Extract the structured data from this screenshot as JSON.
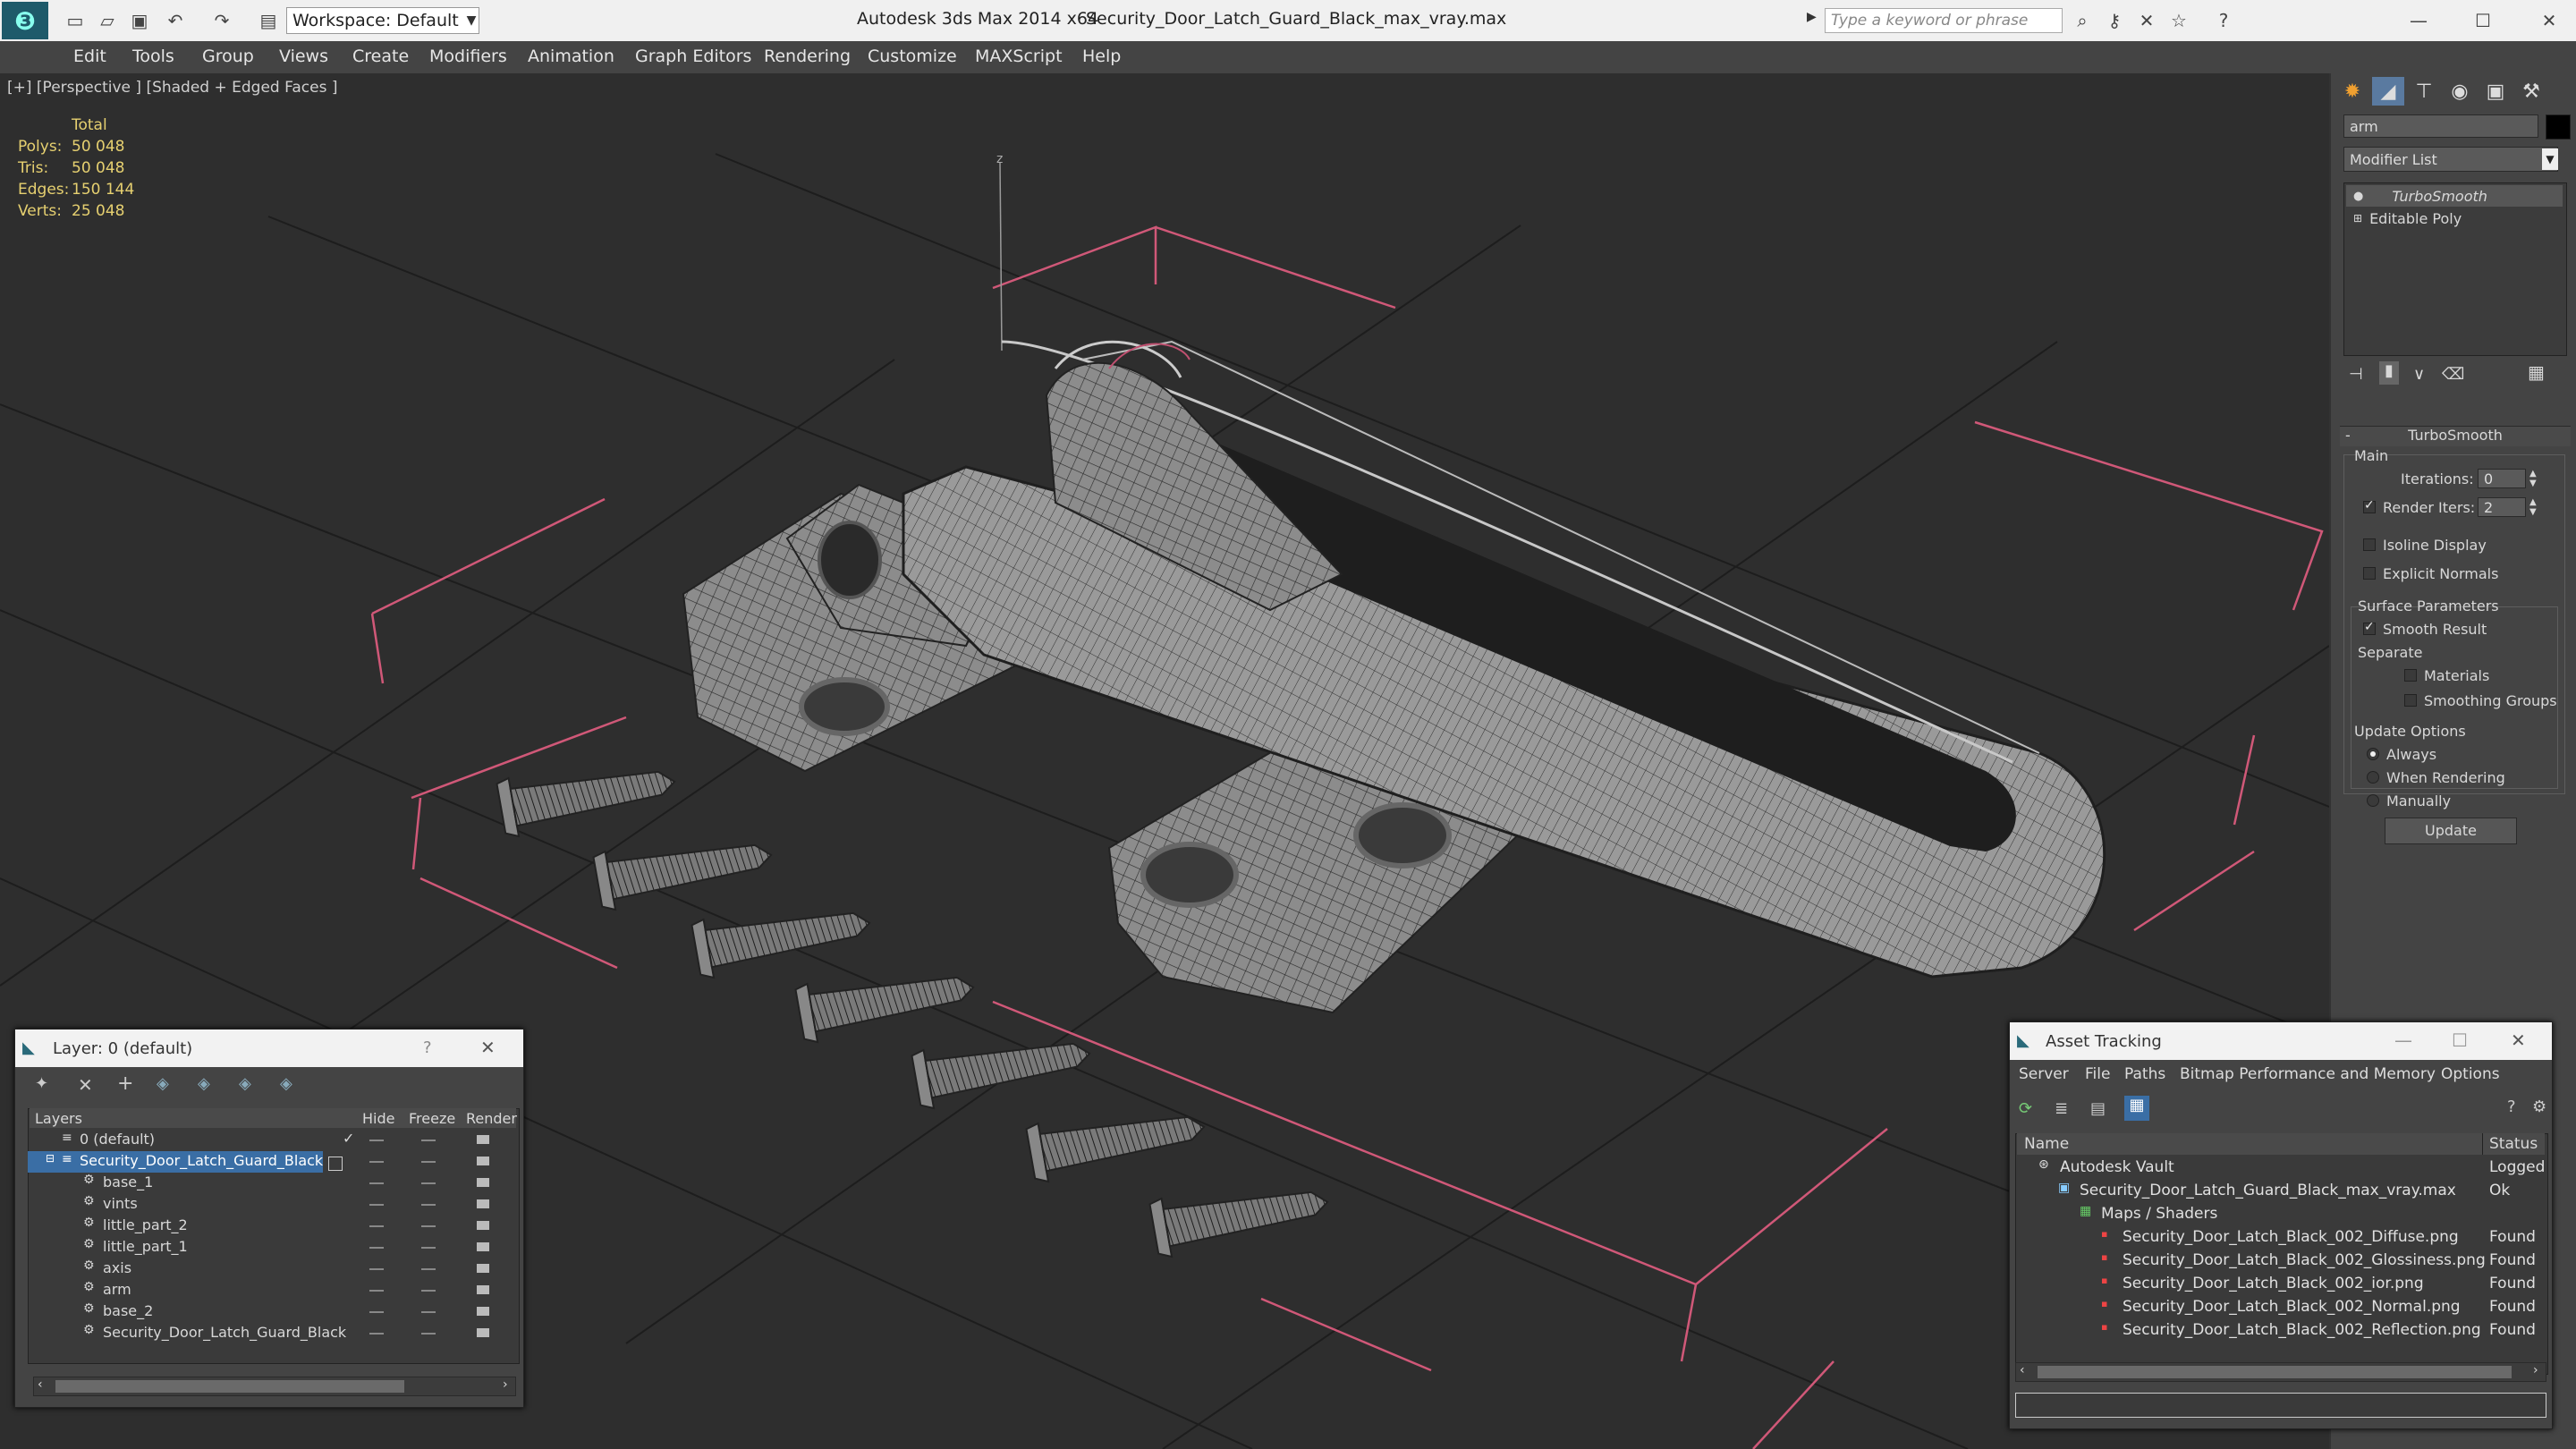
{
  "app": {
    "title": "Autodesk 3ds Max  2014 x64",
    "file": "Security_Door_Latch_Guard_Black_max_vray.max",
    "workspace": "Workspace: Default",
    "search_placeholder": "Type a keyword or phrase"
  },
  "menu": [
    "Edit",
    "Tools",
    "Group",
    "Views",
    "Create",
    "Modifiers",
    "Animation",
    "Graph Editors",
    "Rendering",
    "Customize",
    "MAXScript",
    "Help"
  ],
  "viewport": {
    "label": "[+] [Perspective ] [Shaded + Edged Faces ]",
    "stats": {
      "header": "Total",
      "polys_label": "Polys:",
      "polys": "50 048",
      "tris_label": "Tris:",
      "tris": "50 048",
      "edges_label": "Edges:",
      "edges": "150 144",
      "verts_label": "Verts:",
      "verts": "25 048"
    },
    "axis_label": "z"
  },
  "command_panel": {
    "object_name": "arm",
    "modifier_list": "Modifier List",
    "stack": [
      "TurboSmooth",
      "Editable Poly"
    ],
    "rollout_title": "TurboSmooth",
    "main_label": "Main",
    "iterations_label": "Iterations:",
    "iterations": "0",
    "render_iters_label": "Render Iters:",
    "render_iters": "2",
    "isoline": "Isoline Display",
    "explicit_normals": "Explicit Normals",
    "surface_params": "Surface Parameters",
    "smooth_result": "Smooth Result",
    "separate": "Separate",
    "materials": "Materials",
    "smoothing_groups": "Smoothing Groups",
    "update_options": "Update Options",
    "always": "Always",
    "when_rendering": "When Rendering",
    "manually": "Manually",
    "update_button": "Update",
    "colors": {
      "bg": "#444444",
      "field": "#5a5a5a"
    }
  },
  "layer_dialog": {
    "title": "Layer: 0 (default)",
    "help": "?",
    "columns": [
      "Layers",
      "Hide",
      "Freeze",
      "Render"
    ],
    "rows": [
      {
        "name": "0 (default)",
        "indent": 0
      },
      {
        "name": "Security_Door_Latch_Guard_Black",
        "indent": 0
      },
      {
        "name": "base_1",
        "indent": 1
      },
      {
        "name": "vints",
        "indent": 1
      },
      {
        "name": "little_part_2",
        "indent": 1
      },
      {
        "name": "little_part_1",
        "indent": 1
      },
      {
        "name": "axis",
        "indent": 1
      },
      {
        "name": "arm",
        "indent": 1
      },
      {
        "name": "base_2",
        "indent": 1
      },
      {
        "name": "Security_Door_Latch_Guard_Black",
        "indent": 1
      }
    ]
  },
  "asset_dialog": {
    "title": "Asset Tracking",
    "menu": [
      "Server",
      "File",
      "Paths",
      "Bitmap Performance and Memory",
      "Options"
    ],
    "columns": [
      "Name",
      "Status"
    ],
    "rows": [
      {
        "name": "Autodesk Vault",
        "status": "Logged"
      },
      {
        "name": "Security_Door_Latch_Guard_Black_max_vray.max",
        "status": "Ok"
      },
      {
        "name": "Maps / Shaders",
        "status": ""
      },
      {
        "name": "Security_Door_Latch_Black_002_Diffuse.png",
        "status": "Found"
      },
      {
        "name": "Security_Door_Latch_Black_002_Glossiness.png",
        "status": "Found"
      },
      {
        "name": "Security_Door_Latch_Black_002_ior.png",
        "status": "Found"
      },
      {
        "name": "Security_Door_Latch_Black_002_Normal.png",
        "status": "Found"
      },
      {
        "name": "Security_Door_Latch_Black_002_Reflection.png",
        "status": "Found"
      }
    ]
  },
  "colors": {
    "selection": "#3a6ea5",
    "stats": "#e6d070",
    "bounds": "#e06080"
  }
}
